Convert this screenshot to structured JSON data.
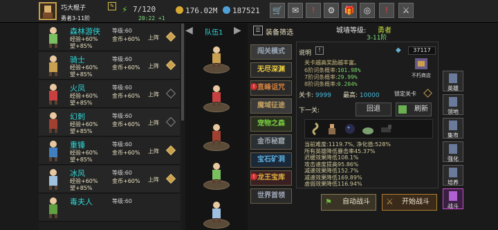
{
  "player": {
    "name": "巧大棍子",
    "rank": "勇者3-11阶",
    "energy": "7/120",
    "energy_timer": "20:22 +1",
    "gold": "176.02M",
    "gems": "187521"
  },
  "icons": {
    "top_buttons": [
      "shop-cart-icon",
      "mail-icon",
      "alert-icon",
      "gear-icon",
      "gift-icon",
      "wheel-icon",
      "alert-icon-2",
      "swords-icon"
    ]
  },
  "heroes": [
    {
      "name": "森林游侠",
      "level": "等级:60",
      "bonus1": "经验+60%",
      "bonus2": "望+85%",
      "gold": "金币+60%",
      "deploy": "上阵",
      "selected": true,
      "color": "#7ac060"
    },
    {
      "name": "骑士",
      "level": "等级:60",
      "bonus1": "经验+60%",
      "bonus2": "望+85%",
      "gold": "金币+60%",
      "deploy": "上阵",
      "selected": true,
      "color": "#c8a050"
    },
    {
      "name": "火凤",
      "level": "等级:60",
      "bonus1": "经验+60%",
      "bonus2": "望+85%",
      "gold": "金币+60%",
      "deploy": "上阵",
      "selected": false,
      "color": "#c84040"
    },
    {
      "name": "幻刺",
      "level": "等级:60",
      "bonus1": "经验+60%",
      "bonus2": "望+85%",
      "gold": "金币+60%",
      "deploy": "上阵",
      "selected": false,
      "color": "#a04030"
    },
    {
      "name": "重锤",
      "level": "等级:60",
      "bonus1": "经验+60%",
      "bonus2": "望+85%",
      "gold": "金币+60%",
      "deploy": "上阵",
      "selected": true,
      "color": "#4080c0"
    },
    {
      "name": "冰风",
      "level": "等级:60",
      "bonus1": "经验+60%",
      "bonus2": "望+85%",
      "gold": "金币+60%",
      "deploy": "上阵",
      "selected": true,
      "color": "#a0c0e0"
    },
    {
      "name": "毒夫人",
      "level": "等级:60",
      "bonus1": "",
      "bonus2": "",
      "gold": "",
      "deploy": "",
      "selected": false,
      "color": "#60a040"
    }
  ],
  "team": {
    "label": "队伍1",
    "members_colors": [
      "#c8a050",
      "#c84040",
      "#a04030",
      "#7ac060",
      "#a0c0e0"
    ]
  },
  "filter": {
    "label": "装备筛选"
  },
  "modes": [
    {
      "label": "闯关模式",
      "color": "#9aa8b8",
      "bg": "#3a3a3a",
      "alert": false
    },
    {
      "label": "无尽深渊",
      "color": "#f0d040",
      "bg": "#2a2a2a",
      "alert": false
    },
    {
      "label": "直峰诅咒",
      "color": "#d08040",
      "bg": "#2a2a2a",
      "alert": true
    },
    {
      "label": "魔域征途",
      "color": "#c0a060",
      "bg": "#3a3a3a",
      "alert": false
    },
    {
      "label": "宠物之森",
      "color": "#7ad040",
      "bg": "#2a3020",
      "alert": false
    },
    {
      "label": "金币秘窟",
      "color": "#a0a8b0",
      "bg": "#2a2f33",
      "alert": false
    },
    {
      "label": "宝石矿洞",
      "color": "#60b0e0",
      "bg": "#1a2838",
      "alert": false
    },
    {
      "label": "龙王宝库",
      "color": "#e0b040",
      "bg": "#3a2020",
      "alert": true
    },
    {
      "label": "世界首领",
      "color": "#a0a8b8",
      "bg": "#2a2a2a",
      "alert": false
    }
  ],
  "city": {
    "label": "城墙等级:",
    "rank": "勇者",
    "range": "3-11阶"
  },
  "info": {
    "desc_label": "说明",
    "desc_text": "关卡越高奖励越丰富。",
    "rates": [
      {
        "label": "6阶词条概率:",
        "value": "101.98%"
      },
      {
        "label": "7阶词条概率:",
        "value": "29.99%"
      },
      {
        "label": "8阶词条概率:",
        "value": "0.204%"
      }
    ],
    "tickets": "37117",
    "shop_label": "不朽商店",
    "stage_label": "关卡:",
    "stage_value": "9999",
    "max_label": "最高:",
    "max_value": "10000",
    "lock_label": "锁定关卡",
    "next_label": "下一关:",
    "return_label": "回退",
    "refresh_label": "刷新",
    "stats": [
      "当前难度:1119.7%, 净化值:528%",
      "所有英雄降低暴击率45.37%",
      "迟缓效果降低108.1%",
      "攻击速度提高95.86%",
      "减速效果降低152.7%",
      "减速效果降低169.89%",
      "虚弱效果降低116.94%"
    ]
  },
  "actions": {
    "auto_battle": "自动战斗",
    "start_battle": "开始战斗"
  },
  "side_nav": [
    {
      "label": "英雄",
      "icon": "hero-icon",
      "active": false
    },
    {
      "label": "领地",
      "icon": "territory-icon",
      "active": false
    },
    {
      "label": "集市",
      "icon": "market-icon",
      "active": false
    },
    {
      "label": "强化",
      "icon": "upgrade-icon",
      "active": false
    },
    {
      "label": "培养",
      "icon": "train-icon",
      "active": false
    },
    {
      "label": "战斗",
      "icon": "battle-icon",
      "active": true
    }
  ]
}
